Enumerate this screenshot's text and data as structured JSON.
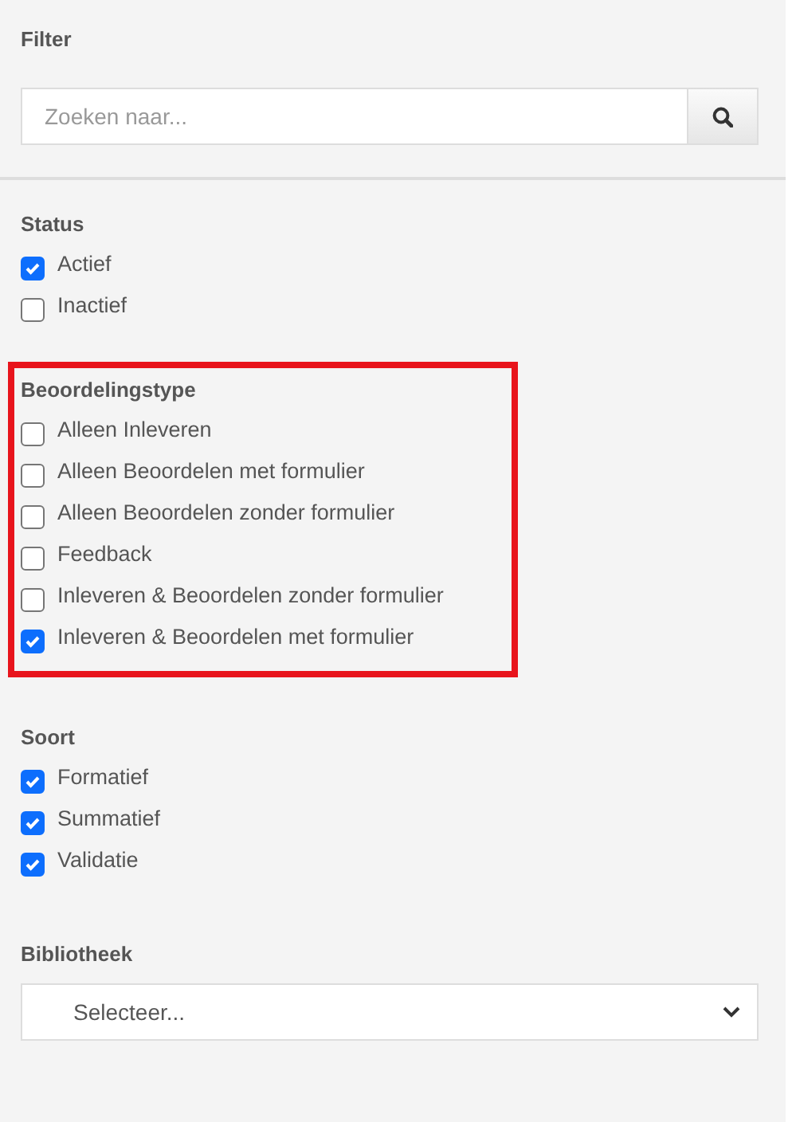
{
  "filter": {
    "title": "Filter",
    "search": {
      "placeholder": "Zoeken naar..."
    }
  },
  "sections": [
    {
      "kind": "checkboxes",
      "title": "Status",
      "options": [
        {
          "label": "Actief",
          "checked": true
        },
        {
          "label": "Inactief",
          "checked": false
        }
      ]
    },
    {
      "kind": "checkboxes",
      "title": "Beoordelingstype",
      "highlighted": true,
      "options": [
        {
          "label": "Alleen Inleveren",
          "checked": false
        },
        {
          "label": "Alleen Beoordelen met formulier",
          "checked": false
        },
        {
          "label": "Alleen Beoordelen zonder formulier",
          "checked": false
        },
        {
          "label": "Feedback",
          "checked": false
        },
        {
          "label": "Inleveren & Beoordelen zonder formulier",
          "checked": false
        },
        {
          "label": "Inleveren & Beoordelen met formulier",
          "checked": true
        }
      ]
    },
    {
      "kind": "checkboxes",
      "title": "Soort",
      "options": [
        {
          "label": "Formatief",
          "checked": true
        },
        {
          "label": "Summatief",
          "checked": true
        },
        {
          "label": "Validatie",
          "checked": true
        }
      ]
    },
    {
      "kind": "select",
      "title": "Bibliotheek",
      "placeholder": "Selecteer..."
    }
  ]
}
